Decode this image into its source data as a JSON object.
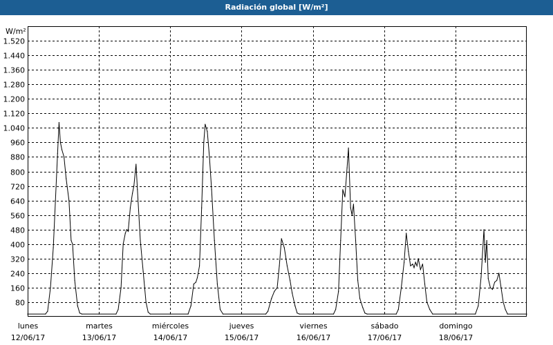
{
  "window": {
    "title": "Radiación global [W/m²]"
  },
  "colors": {
    "title_bar": "#1c5e93",
    "title_text": "#ffffff",
    "line": "#000000",
    "grid": "#000000",
    "background": "#ffffff"
  },
  "chart_data": {
    "type": "line",
    "title": "Radiación global [W/m²]",
    "ylabel": "W/m²",
    "xlabel": "",
    "ylim": [
      0,
      1600
    ],
    "xlim": [
      0,
      7
    ],
    "grid": true,
    "grid_style": "dashed",
    "yticks": [
      {
        "value": 80,
        "label": "80"
      },
      {
        "value": 160,
        "label": "160"
      },
      {
        "value": 240,
        "label": "240"
      },
      {
        "value": 320,
        "label": "320"
      },
      {
        "value": 400,
        "label": "400"
      },
      {
        "value": 480,
        "label": "480"
      },
      {
        "value": 560,
        "label": "560"
      },
      {
        "value": 640,
        "label": "640"
      },
      {
        "value": 720,
        "label": "720"
      },
      {
        "value": 800,
        "label": "800"
      },
      {
        "value": 880,
        "label": "880"
      },
      {
        "value": 960,
        "label": "960"
      },
      {
        "value": 1040,
        "label": "1.040"
      },
      {
        "value": 1120,
        "label": "1.120"
      },
      {
        "value": 1200,
        "label": "1.200"
      },
      {
        "value": 1280,
        "label": "1.280"
      },
      {
        "value": 1360,
        "label": "1.360"
      },
      {
        "value": 1440,
        "label": "1.440"
      },
      {
        "value": 1520,
        "label": "1.520"
      }
    ],
    "xticks": [
      {
        "value": 0,
        "day": "lunes",
        "date": "12/06/17"
      },
      {
        "value": 1,
        "day": "martes",
        "date": "13/06/17"
      },
      {
        "value": 2,
        "day": "miércoles",
        "date": "14/06/17"
      },
      {
        "value": 3,
        "day": "jueves",
        "date": "15/06/17"
      },
      {
        "value": 4,
        "day": "viernes",
        "date": "16/06/17"
      },
      {
        "value": 5,
        "day": "sábado",
        "date": "17/06/17"
      },
      {
        "value": 6,
        "day": "domingo",
        "date": "18/06/17"
      }
    ],
    "series": [
      {
        "points": [
          [
            0.0,
            15
          ],
          [
            0.25,
            15
          ],
          [
            0.28,
            30
          ],
          [
            0.32,
            160
          ],
          [
            0.36,
            380
          ],
          [
            0.39,
            640
          ],
          [
            0.42,
            900
          ],
          [
            0.44,
            1070
          ],
          [
            0.46,
            960
          ],
          [
            0.48,
            920
          ],
          [
            0.51,
            880
          ],
          [
            0.54,
            760
          ],
          [
            0.58,
            640
          ],
          [
            0.61,
            420
          ],
          [
            0.63,
            400
          ],
          [
            0.66,
            200
          ],
          [
            0.7,
            60
          ],
          [
            0.73,
            20
          ],
          [
            0.76,
            15
          ],
          [
            1.0,
            15
          ],
          [
            1.24,
            15
          ],
          [
            1.27,
            40
          ],
          [
            1.31,
            160
          ],
          [
            1.34,
            400
          ],
          [
            1.37,
            460
          ],
          [
            1.39,
            480
          ],
          [
            1.41,
            470
          ],
          [
            1.44,
            600
          ],
          [
            1.47,
            680
          ],
          [
            1.49,
            720
          ],
          [
            1.52,
            840
          ],
          [
            1.54,
            700
          ],
          [
            1.58,
            420
          ],
          [
            1.62,
            250
          ],
          [
            1.66,
            80
          ],
          [
            1.69,
            25
          ],
          [
            1.72,
            15
          ],
          [
            2.0,
            15
          ],
          [
            2.25,
            15
          ],
          [
            2.29,
            60
          ],
          [
            2.33,
            180
          ],
          [
            2.36,
            190
          ],
          [
            2.38,
            215
          ],
          [
            2.41,
            280
          ],
          [
            2.44,
            600
          ],
          [
            2.47,
            960
          ],
          [
            2.49,
            1060
          ],
          [
            2.52,
            1020
          ],
          [
            2.55,
            880
          ],
          [
            2.58,
            700
          ],
          [
            2.62,
            420
          ],
          [
            2.66,
            180
          ],
          [
            2.7,
            40
          ],
          [
            2.74,
            15
          ],
          [
            3.0,
            15
          ],
          [
            3.34,
            15
          ],
          [
            3.37,
            30
          ],
          [
            3.42,
            100
          ],
          [
            3.46,
            140
          ],
          [
            3.5,
            160
          ],
          [
            3.53,
            280
          ],
          [
            3.56,
            430
          ],
          [
            3.6,
            380
          ],
          [
            3.64,
            280
          ],
          [
            3.68,
            200
          ],
          [
            3.71,
            130
          ],
          [
            3.75,
            60
          ],
          [
            3.78,
            20
          ],
          [
            3.81,
            15
          ],
          [
            4.0,
            15
          ],
          [
            4.29,
            15
          ],
          [
            4.32,
            40
          ],
          [
            4.36,
            140
          ],
          [
            4.39,
            420
          ],
          [
            4.42,
            700
          ],
          [
            4.45,
            660
          ],
          [
            4.48,
            820
          ],
          [
            4.5,
            930
          ],
          [
            4.53,
            600
          ],
          [
            4.55,
            560
          ],
          [
            4.57,
            620
          ],
          [
            4.6,
            420
          ],
          [
            4.63,
            200
          ],
          [
            4.66,
            100
          ],
          [
            4.7,
            50
          ],
          [
            4.73,
            20
          ],
          [
            4.76,
            15
          ],
          [
            5.0,
            15
          ],
          [
            5.17,
            15
          ],
          [
            5.2,
            40
          ],
          [
            5.24,
            160
          ],
          [
            5.28,
            300
          ],
          [
            5.31,
            460
          ],
          [
            5.34,
            360
          ],
          [
            5.37,
            280
          ],
          [
            5.4,
            290
          ],
          [
            5.42,
            270
          ],
          [
            5.44,
            300
          ],
          [
            5.46,
            280
          ],
          [
            5.48,
            320
          ],
          [
            5.51,
            260
          ],
          [
            5.54,
            290
          ],
          [
            5.57,
            180
          ],
          [
            5.6,
            80
          ],
          [
            5.64,
            40
          ],
          [
            5.68,
            15
          ],
          [
            6.0,
            15
          ],
          [
            6.28,
            15
          ],
          [
            6.32,
            60
          ],
          [
            6.36,
            220
          ],
          [
            6.4,
            480
          ],
          [
            6.42,
            300
          ],
          [
            6.44,
            420
          ],
          [
            6.46,
            210
          ],
          [
            6.49,
            160
          ],
          [
            6.52,
            150
          ],
          [
            6.55,
            190
          ],
          [
            6.58,
            200
          ],
          [
            6.61,
            240
          ],
          [
            6.64,
            160
          ],
          [
            6.67,
            80
          ],
          [
            6.7,
            40
          ],
          [
            6.73,
            15
          ],
          [
            7.0,
            15
          ]
        ]
      }
    ]
  }
}
